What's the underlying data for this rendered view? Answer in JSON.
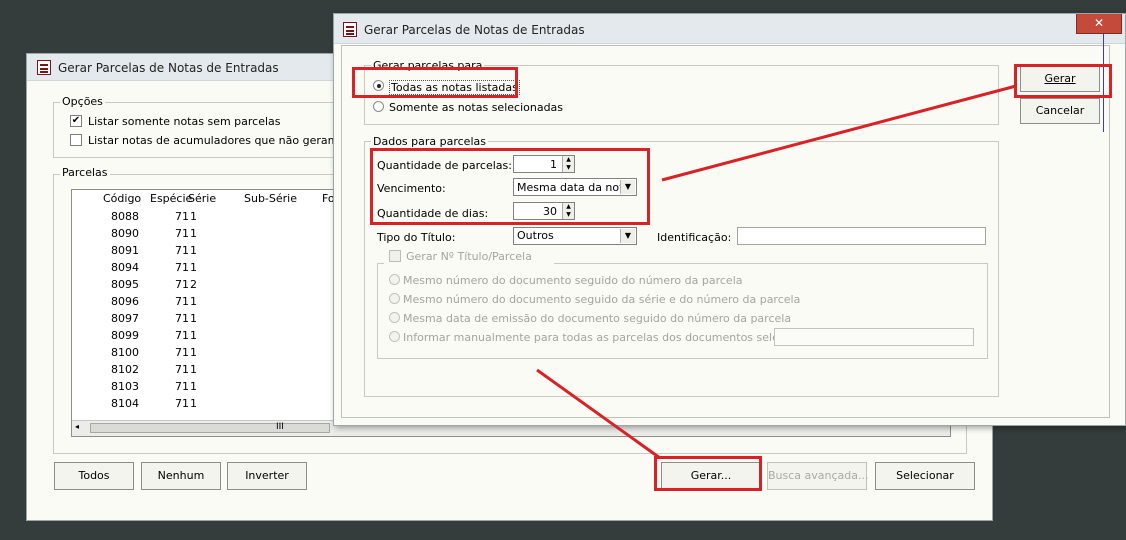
{
  "back_window": {
    "title": "Gerar Parcelas de Notas de Entradas",
    "options_group": {
      "legend": "Opções",
      "opt1": {
        "label": "Listar somente notas sem parcelas",
        "checked": true
      },
      "opt2": {
        "label": "Listar notas de acumuladores que não geram parcel",
        "checked": false
      }
    },
    "parcelas_group": {
      "legend": "Parcelas",
      "columns": [
        "Código",
        "Espécie",
        "Série",
        "Sub-Série",
        "Fo"
      ],
      "rows": [
        {
          "codigo": "8088",
          "especie": "71",
          "serie": "1"
        },
        {
          "codigo": "8090",
          "especie": "71",
          "serie": "1"
        },
        {
          "codigo": "8091",
          "especie": "71",
          "serie": "1"
        },
        {
          "codigo": "8094",
          "especie": "71",
          "serie": "1"
        },
        {
          "codigo": "8095",
          "especie": "71",
          "serie": "2"
        },
        {
          "codigo": "8096",
          "especie": "71",
          "serie": "1"
        },
        {
          "codigo": "8097",
          "especie": "71",
          "serie": "1"
        },
        {
          "codigo": "8099",
          "especie": "71",
          "serie": "1"
        },
        {
          "codigo": "8100",
          "especie": "71",
          "serie": "1"
        },
        {
          "codigo": "8102",
          "especie": "71",
          "serie": "1"
        },
        {
          "codigo": "8103",
          "especie": "71",
          "serie": "1"
        },
        {
          "codigo": "8104",
          "especie": "71",
          "serie": "1"
        }
      ],
      "scroll_grip": "III"
    },
    "buttons": {
      "todos": "Todos",
      "nenhum": "Nenhum",
      "inverter": "Inverter",
      "gerar": "Gerar...",
      "busca": "Busca avançada...",
      "selecionar": "Selecionar"
    }
  },
  "dialog": {
    "title": "Gerar Parcelas de Notas de Entradas",
    "close_symbol": "✕",
    "gerar_para": {
      "legend": "Gerar parcelas para",
      "todas": {
        "label": "Todas as notas listadas",
        "selected": true
      },
      "somente": {
        "label": "Somente as notas selecionadas",
        "selected": false
      }
    },
    "dados": {
      "legend": "Dados para parcelas",
      "quantidade_parcelas": {
        "label": "Quantidade de parcelas:",
        "value": "1"
      },
      "vencimento": {
        "label": "Vencimento:",
        "value": "Mesma data da nota"
      },
      "quantidade_dias": {
        "label": "Quantidade de dias:",
        "value": "30"
      },
      "tipo_titulo": {
        "label": "Tipo do Título:",
        "value": "Outros"
      },
      "identificacao": {
        "label": "Identificação:",
        "value": ""
      },
      "gerar_numero": {
        "label": "Gerar Nº Título/Parcela",
        "checked": false,
        "options": [
          "Mesmo número do documento seguido do número da parcela",
          "Mesmo número do documento seguido da série e do número da parcela",
          "Mesma data de emissão do documento seguido do número da parcela",
          "Informar manualmente para todas as parcelas dos documentos selecionados"
        ]
      }
    },
    "buttons": {
      "gerar": "Gerar",
      "cancelar": "Cancelar"
    }
  },
  "colors": {
    "highlight": "#d82225",
    "desktop": "#353c3c",
    "window_bg": "#fbfbf5"
  }
}
